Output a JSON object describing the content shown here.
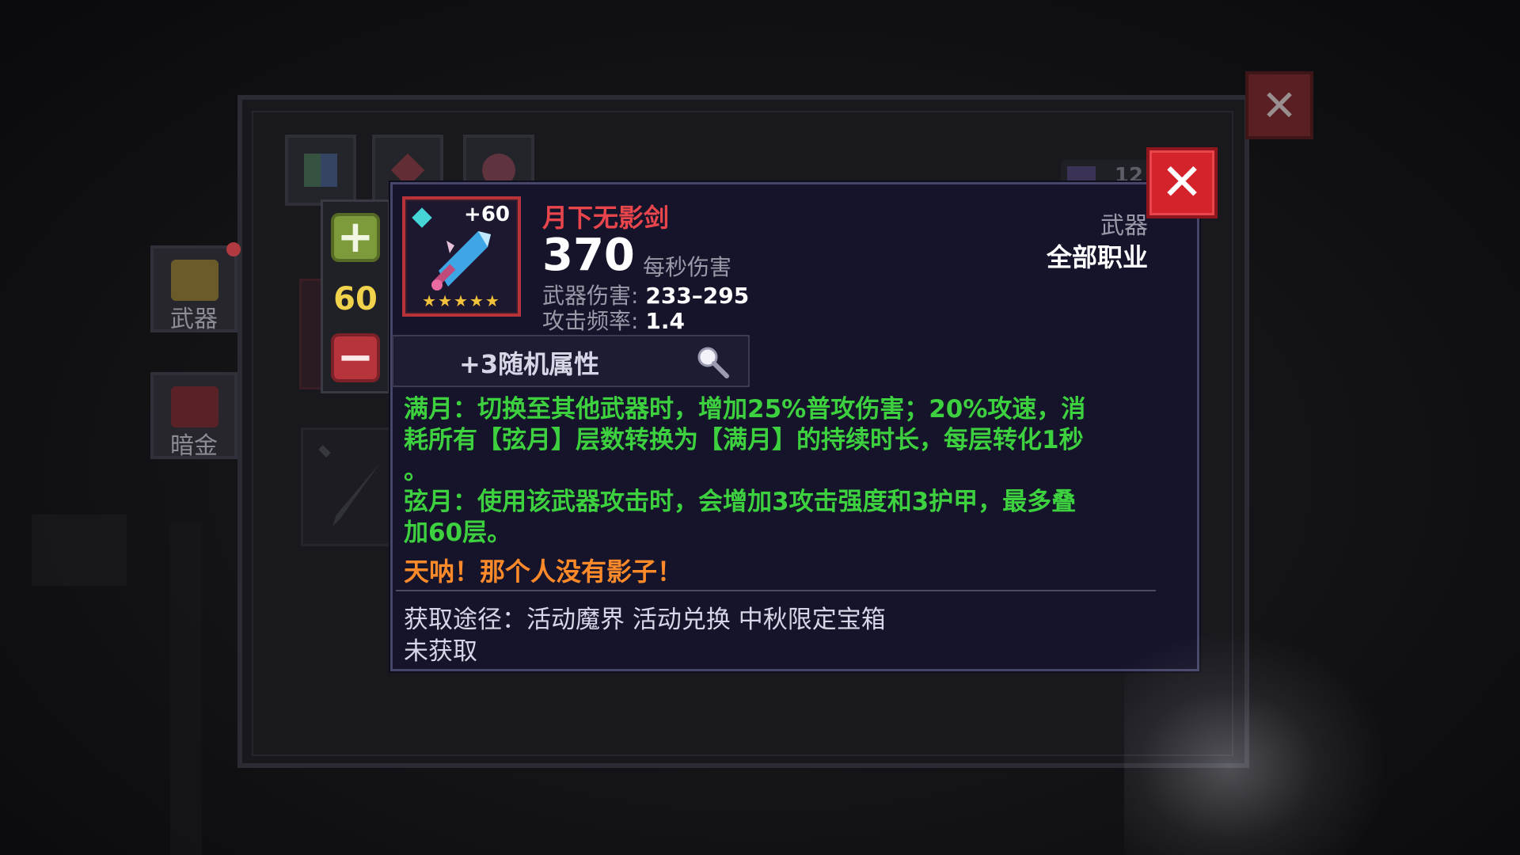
{
  "item": {
    "name": "月下无影剑",
    "enhance_level": "+60",
    "star_rating": 5,
    "stars_text": "★★★★★",
    "dps_value": "370",
    "dps_label": "每秒伤害",
    "damage_label": "武器伤害:",
    "damage_value": "233–295",
    "speed_label": "攻击频率:",
    "speed_value": "1.4",
    "type": "武器",
    "class": "全部职业"
  },
  "stepper": {
    "plus_symbol": "+",
    "value": "60",
    "minus_symbol": "−"
  },
  "random_attr": {
    "label": "+3随机属性"
  },
  "description": {
    "line1": "满月：切换至其他武器时，增加25%普攻伤害；20%攻速，消",
    "line2": "耗所有【弦月】层数转换为【满月】的持续时长，每层转化1秒",
    "line3": "。",
    "line4": "弦月：使用该武器攻击时，会增加3攻击强度和3护甲，最多叠",
    "line5": "加60层。",
    "flavor": "天呐！那个人没有影子！"
  },
  "source": {
    "text": "获取途径：活动魔界  活动兑换 中秋限定宝箱",
    "status": "未获取"
  },
  "sidebar": {
    "tabs": [
      {
        "label": "武器"
      },
      {
        "label": "暗金"
      }
    ]
  },
  "counter": {
    "value": "12"
  },
  "buttons": {
    "close_symbol": "✕"
  },
  "colors": {
    "item_name": "#e9454c",
    "description": "#3dd03f",
    "flavor": "#ff8a2a",
    "stepper_value": "#f1d24c",
    "close_button": "#d5232b"
  }
}
